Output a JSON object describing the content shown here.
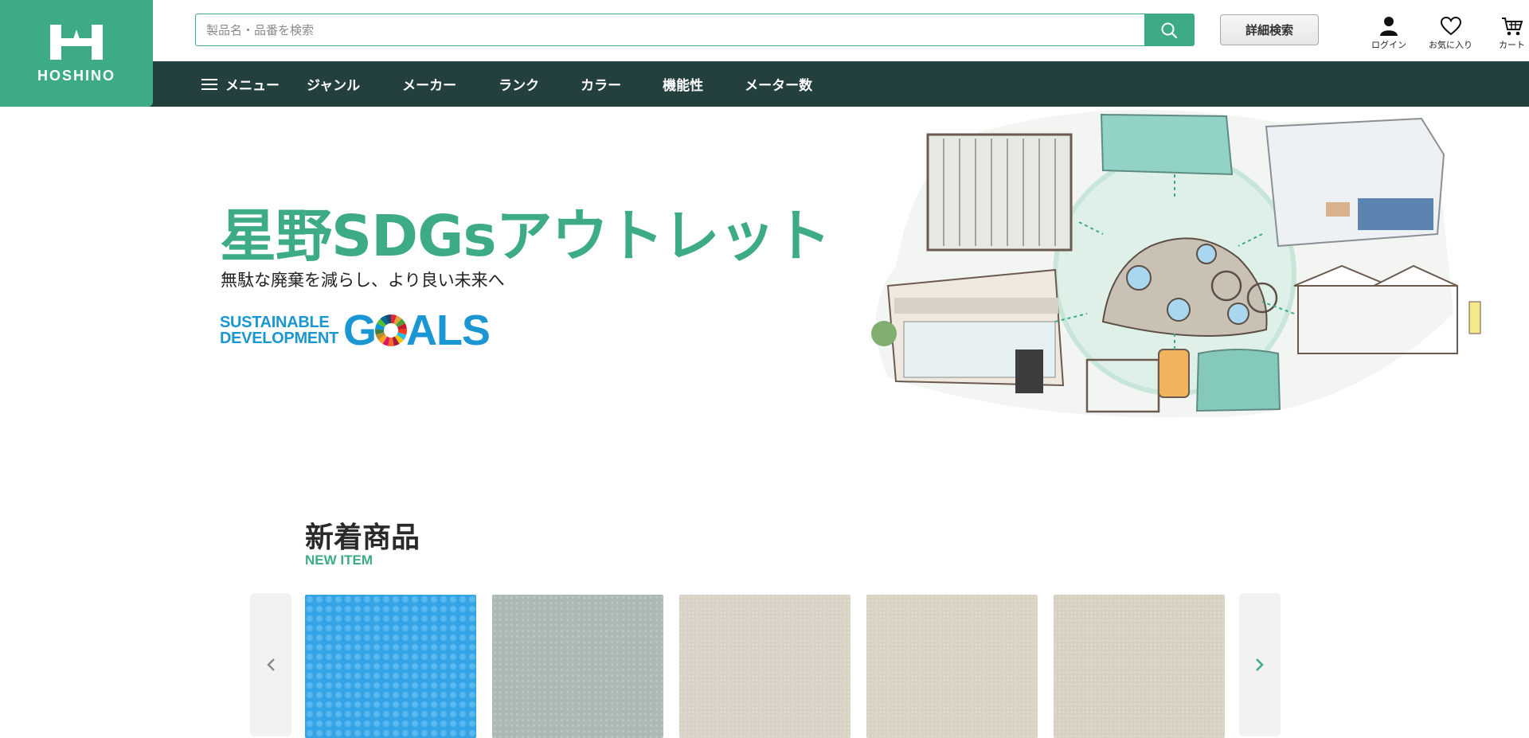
{
  "logo": {
    "text": "HOSHINO"
  },
  "search": {
    "placeholder": "製品名・品番を検索",
    "value": ""
  },
  "detail_search_label": "詳細検索",
  "header_icons": [
    {
      "label": "ログイン",
      "icon": "user-icon"
    },
    {
      "label": "お気に入り",
      "icon": "heart-icon"
    },
    {
      "label": "カート",
      "icon": "cart-icon"
    }
  ],
  "nav": {
    "menu_label": "メニュー",
    "items": [
      {
        "label": "ジャンル"
      },
      {
        "label": "メーカー"
      },
      {
        "label": "ランク"
      },
      {
        "label": "カラー"
      },
      {
        "label": "機能性"
      },
      {
        "label": "メーター数"
      }
    ]
  },
  "hero": {
    "title": "星野SDGsアウトレット",
    "subtitle": "無駄な廃棄を減らし、より良い未来へ",
    "sdg_line1": "SUSTAINABLE",
    "sdg_line2": "DEVELOPMENT",
    "sdg_goals_g": "G",
    "sdg_goals_rest": "ALS"
  },
  "new_items": {
    "title": "新着商品",
    "subtitle": "NEW ITEM",
    "products": [
      {
        "color": "#33a3e6"
      },
      {
        "color": "#adb9b4"
      },
      {
        "color": "#d8d2c5"
      },
      {
        "color": "#d9d2c4"
      },
      {
        "color": "#d7d0c2"
      }
    ]
  },
  "colors": {
    "brand": "#3dab86",
    "nav_bg": "#233f3e",
    "sdg_blue": "#1a96d3"
  }
}
